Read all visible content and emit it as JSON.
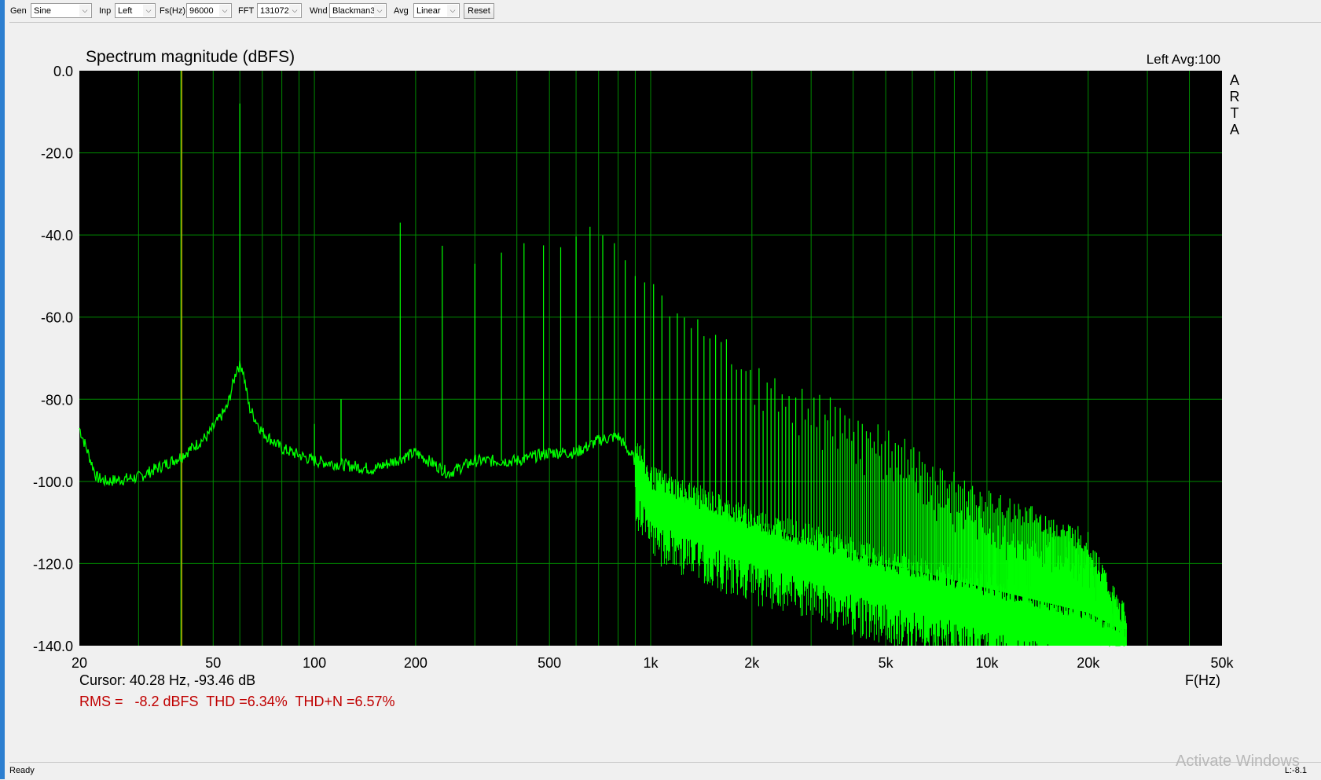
{
  "toolbar": {
    "gen_label": "Gen",
    "gen_value": "Sine",
    "inp_label": "Inp",
    "inp_value": "Left",
    "fs_label": "Fs(Hz)",
    "fs_value": "96000",
    "fft_label": "FFT",
    "fft_value": "131072",
    "wnd_label": "Wnd",
    "wnd_value": "Blackman3",
    "avg_label": "Avg",
    "avg_value": "Linear",
    "reset_label": "Reset"
  },
  "plot": {
    "title": "Spectrum magnitude (dBFS)",
    "channel_avg": "Left  Avg:100",
    "side_logo": [
      "A",
      "R",
      "T",
      "A"
    ],
    "cursor_text": "Cursor: 40.28 Hz, -93.46 dB",
    "cursor_freq_hz": 40.28,
    "readout_text": "RMS =   -8.2 dBFS  THD =6.34%  THD+N =6.57%",
    "xaxis_unit": "F(Hz)"
  },
  "colors": {
    "plot_bg": "#000000",
    "grid": "#008a00",
    "trace": "#00ff00",
    "cursor": "#bcbc00",
    "readout": "#c00000"
  },
  "chart_data": {
    "type": "line",
    "title": "Spectrum magnitude (dBFS)",
    "xlabel": "F(Hz)",
    "ylabel": "",
    "xscale": "log",
    "xlim": [
      20,
      50000
    ],
    "ylim": [
      -140,
      0
    ],
    "grid": true,
    "x_ticks": [
      20,
      50,
      100,
      200,
      500,
      1000,
      2000,
      5000,
      10000,
      20000,
      50000
    ],
    "x_tick_labels": [
      "20",
      "50",
      "100",
      "200",
      "500",
      "1k",
      "2k",
      "5k",
      "10k",
      "20k",
      "50k"
    ],
    "y_ticks": [
      0,
      -20,
      -40,
      -60,
      -80,
      -100,
      -120,
      -140
    ],
    "y_tick_labels": [
      "0.0",
      "-20.0",
      "-40.0",
      "-60.0",
      "-80.0",
      "-100.0",
      "-120.0",
      "-140.0"
    ],
    "fundamental_hz": 60,
    "series": [
      {
        "values_description_free": true,
        "floor": [
          [
            20,
            -87
          ],
          [
            21,
            -92
          ],
          [
            22.5,
            -99
          ],
          [
            24,
            -100
          ],
          [
            30,
            -99
          ],
          [
            40,
            -94
          ],
          [
            48,
            -89
          ],
          [
            55,
            -82
          ],
          [
            59,
            -72
          ],
          [
            61,
            -72
          ],
          [
            64,
            -82
          ],
          [
            70,
            -88
          ],
          [
            80,
            -92
          ],
          [
            100,
            -95
          ],
          [
            150,
            -97
          ],
          [
            200,
            -93
          ],
          [
            250,
            -98
          ],
          [
            300,
            -95
          ],
          [
            400,
            -95
          ],
          [
            500,
            -93
          ],
          [
            600,
            -93
          ],
          [
            700,
            -90
          ],
          [
            800,
            -89
          ],
          [
            900,
            -95
          ],
          [
            1000,
            -104
          ],
          [
            2000,
            -114
          ],
          [
            5000,
            -124
          ],
          [
            10000,
            -130
          ],
          [
            20000,
            -136
          ],
          [
            25000,
            -140
          ]
        ],
        "peaks": [
          [
            60,
            -8
          ],
          [
            100,
            -86
          ],
          [
            120,
            -80
          ],
          [
            180,
            -37
          ],
          [
            300,
            -47
          ],
          [
            420,
            -42
          ],
          [
            540,
            -43
          ],
          [
            660,
            -38
          ],
          [
            780,
            -42
          ],
          [
            900,
            -50
          ],
          [
            1020,
            -53
          ],
          [
            1140,
            -58
          ],
          [
            1260,
            -60
          ],
          [
            1380,
            -62
          ],
          [
            1500,
            -68
          ],
          [
            1620,
            -65
          ],
          [
            1740,
            -70
          ],
          [
            2000,
            -73
          ],
          [
            3000,
            -80
          ],
          [
            5000,
            -89
          ],
          [
            7000,
            -98
          ],
          [
            10000,
            -105
          ],
          [
            15000,
            -110
          ],
          [
            20000,
            -115
          ],
          [
            25000,
            -132
          ]
        ]
      }
    ]
  },
  "status": {
    "left": "Ready",
    "right": "L:-8.1",
    "watermark": "Activate Windows"
  }
}
